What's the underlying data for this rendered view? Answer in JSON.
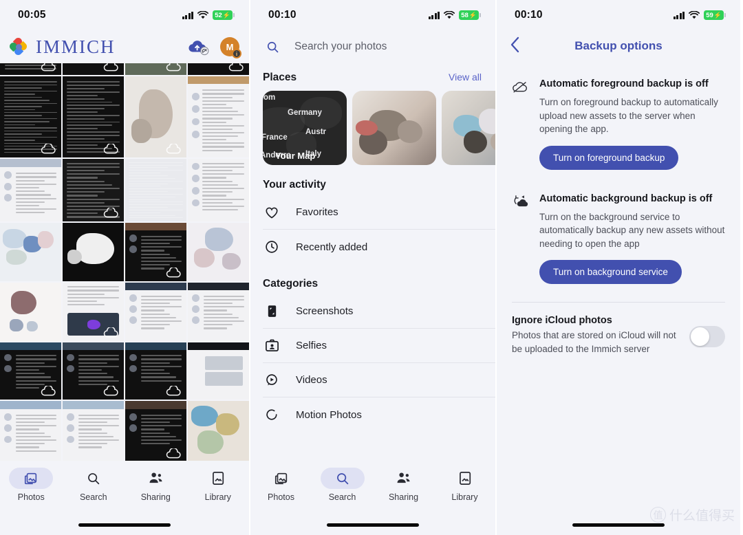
{
  "panel1": {
    "status": {
      "time": "00:05",
      "battery": "52",
      "charging": true
    },
    "brand": "IMMICH",
    "icons": {
      "cloud_upload": "cloud-upload-icon",
      "avatar_letter": "M",
      "avatar_badge": "i"
    },
    "nav": {
      "items": [
        {
          "label": "Photos",
          "icon": "photos-icon",
          "active": true
        },
        {
          "label": "Search",
          "icon": "search-icon",
          "active": false
        },
        {
          "label": "Sharing",
          "icon": "sharing-icon",
          "active": false
        },
        {
          "label": "Library",
          "icon": "library-icon",
          "active": false
        }
      ]
    }
  },
  "panel2": {
    "status": {
      "time": "00:10",
      "battery": "58",
      "charging": true
    },
    "search": {
      "placeholder": "Search your photos",
      "icon": "search-icon"
    },
    "places": {
      "title": "Places",
      "view_all": "View all",
      "map_card": {
        "label": "Your Map",
        "countries": [
          "dom",
          "Germany",
          "France",
          "Austr",
          "Andorra",
          "Italy"
        ]
      }
    },
    "activity": {
      "title": "Your activity",
      "items": [
        {
          "label": "Favorites",
          "icon": "heart-icon"
        },
        {
          "label": "Recently added",
          "icon": "clock-icon"
        }
      ]
    },
    "categories": {
      "title": "Categories",
      "items": [
        {
          "label": "Screenshots",
          "icon": "screenshot-icon"
        },
        {
          "label": "Selfies",
          "icon": "selfie-icon"
        },
        {
          "label": "Videos",
          "icon": "video-icon"
        },
        {
          "label": "Motion Photos",
          "icon": "motion-photo-icon"
        }
      ]
    },
    "nav": {
      "items": [
        {
          "label": "Photos",
          "icon": "photos-icon",
          "active": false
        },
        {
          "label": "Search",
          "icon": "search-icon",
          "active": true
        },
        {
          "label": "Sharing",
          "icon": "sharing-icon",
          "active": false
        },
        {
          "label": "Library",
          "icon": "library-icon",
          "active": false
        }
      ]
    }
  },
  "panel3": {
    "status": {
      "time": "00:10",
      "battery": "59",
      "charging": true
    },
    "nav": {
      "back": "chevron-left-icon",
      "title": "Backup options"
    },
    "foreground": {
      "icon": "cloud-off-icon",
      "title": "Automatic foreground backup is off",
      "description": "Turn on foreground backup to automatically upload new assets to the server when opening the app.",
      "button": "Turn on foreground backup"
    },
    "background": {
      "icon": "cloud-sync-icon",
      "title": "Automatic background backup is off",
      "description": "Turn on the background service to automatically backup any new assets without needing to open the app",
      "button": "Turn on background service"
    },
    "icloud": {
      "title": "Ignore iCloud photos",
      "description": "Photos that are stored on iCloud will not be uploaded to the Immich server",
      "toggle_on": false
    }
  },
  "watermark": {
    "mark": "值",
    "text": "什么值得买"
  },
  "colors": {
    "accent": "#4250af",
    "background": "#f3f4f9",
    "battery_green": "#30d158",
    "avatar_orange": "#d4822a"
  }
}
